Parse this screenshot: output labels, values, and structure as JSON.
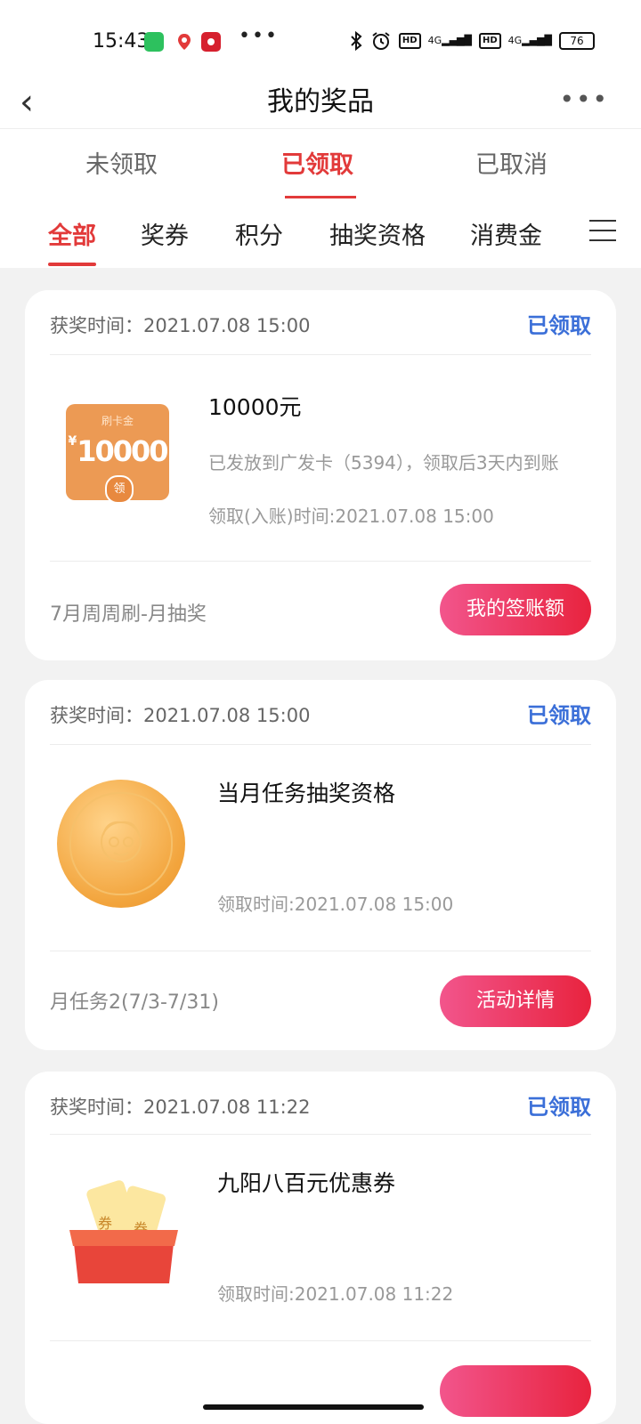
{
  "status_bar": {
    "time": "15:43",
    "battery": "76",
    "network_a": "4G",
    "network_b": "4G",
    "hd_a": "HD",
    "hd_b": "HD"
  },
  "nav": {
    "title": "我的奖品"
  },
  "tabs_primary": [
    {
      "label": "未领取"
    },
    {
      "label": "已领取",
      "active": true
    },
    {
      "label": "已取消"
    }
  ],
  "tabs_secondary": [
    {
      "label": "全部",
      "active": true
    },
    {
      "label": "奖券"
    },
    {
      "label": "积分"
    },
    {
      "label": "抽奖资格"
    },
    {
      "label": "消费金"
    }
  ],
  "colors": {
    "accent": "#e23a3a",
    "status_blue": "#3b6fd8",
    "button_start": "#f2558c",
    "button_end": "#e8233e"
  },
  "prizes": [
    {
      "award_time": "获奖时间：2021.07.08 15:00",
      "status": "已领取",
      "name": "10000元",
      "desc": "已发放到广发卡（5394），领取后3天内到账",
      "receive_time": "领取(入账)时间:2021.07.08 15:00",
      "activity": "7月周周刷-月抽奖",
      "button": "我的签账额",
      "image": {
        "icon": "card-voucher-icon",
        "top_label": "刷卡金",
        "currency": "¥",
        "amount": "10000",
        "badge": "领"
      }
    },
    {
      "award_time": "获奖时间：2021.07.08 15:00",
      "status": "已领取",
      "name": "当月任务抽奖资格",
      "receive_time": "领取时间:2021.07.08 15:00",
      "activity": "月任务2(7/3-7/31)",
      "button": "活动详情",
      "image": {
        "icon": "gold-coin-icon"
      }
    },
    {
      "award_time": "获奖时间：2021.07.08 11:22",
      "status": "已领取",
      "name": "九阳八百元优惠券",
      "receive_time": "领取时间:2021.07.08 11:22",
      "image": {
        "icon": "gift-box-coupons-icon",
        "ticket_label": "券"
      }
    }
  ]
}
